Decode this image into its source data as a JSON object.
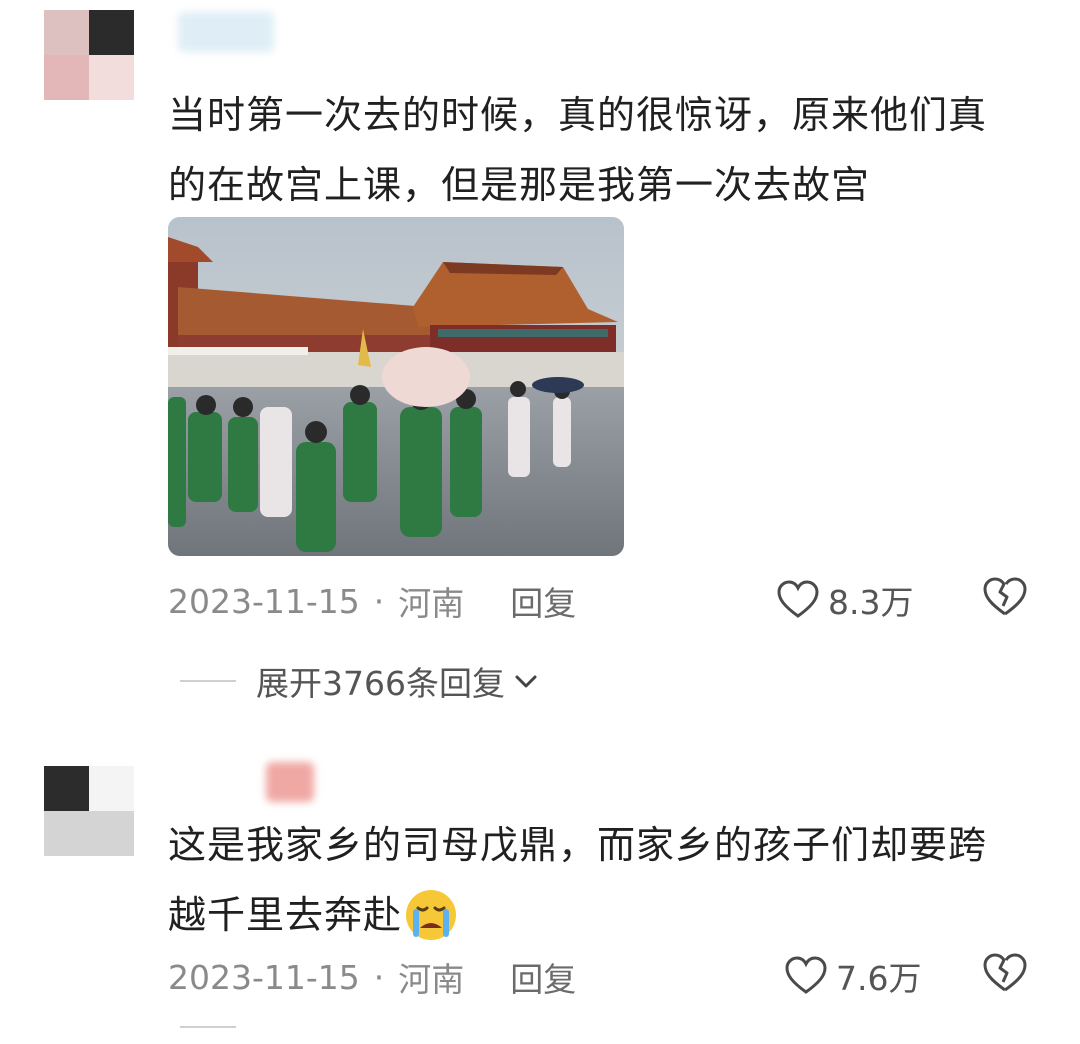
{
  "comments": [
    {
      "text_line1": "当时第一次去的时候，真的很惊讶，原来他们真",
      "text_line2": "的在故宫上课，但是那是我第一次去故宫",
      "date": "2023-11-15",
      "dot": "·",
      "location": "河南",
      "reply_label": "回复",
      "likes": "8.3万",
      "expand_label": "展开3766条回复",
      "icons": {
        "like": "heart-outline-icon",
        "dislike": "broken-heart-icon",
        "expand": "chevron-down-icon"
      }
    },
    {
      "text_line1": "这是我家乡的司母戊鼎，而家乡的孩子们却要跨",
      "text_line2": "越千里去奔赴",
      "emoji": "crying-face-emoji",
      "date": "2023-11-15",
      "dot": "·",
      "location": "河南",
      "reply_label": "回复",
      "likes": "7.6万",
      "icons": {
        "like": "heart-outline-icon",
        "dislike": "broken-heart-icon"
      }
    }
  ],
  "colors": {
    "text": "#202020",
    "meta": "#8a8a8a",
    "avatar_pink": "#e9c9c8",
    "avatar_dark": "#2a2a2a"
  }
}
